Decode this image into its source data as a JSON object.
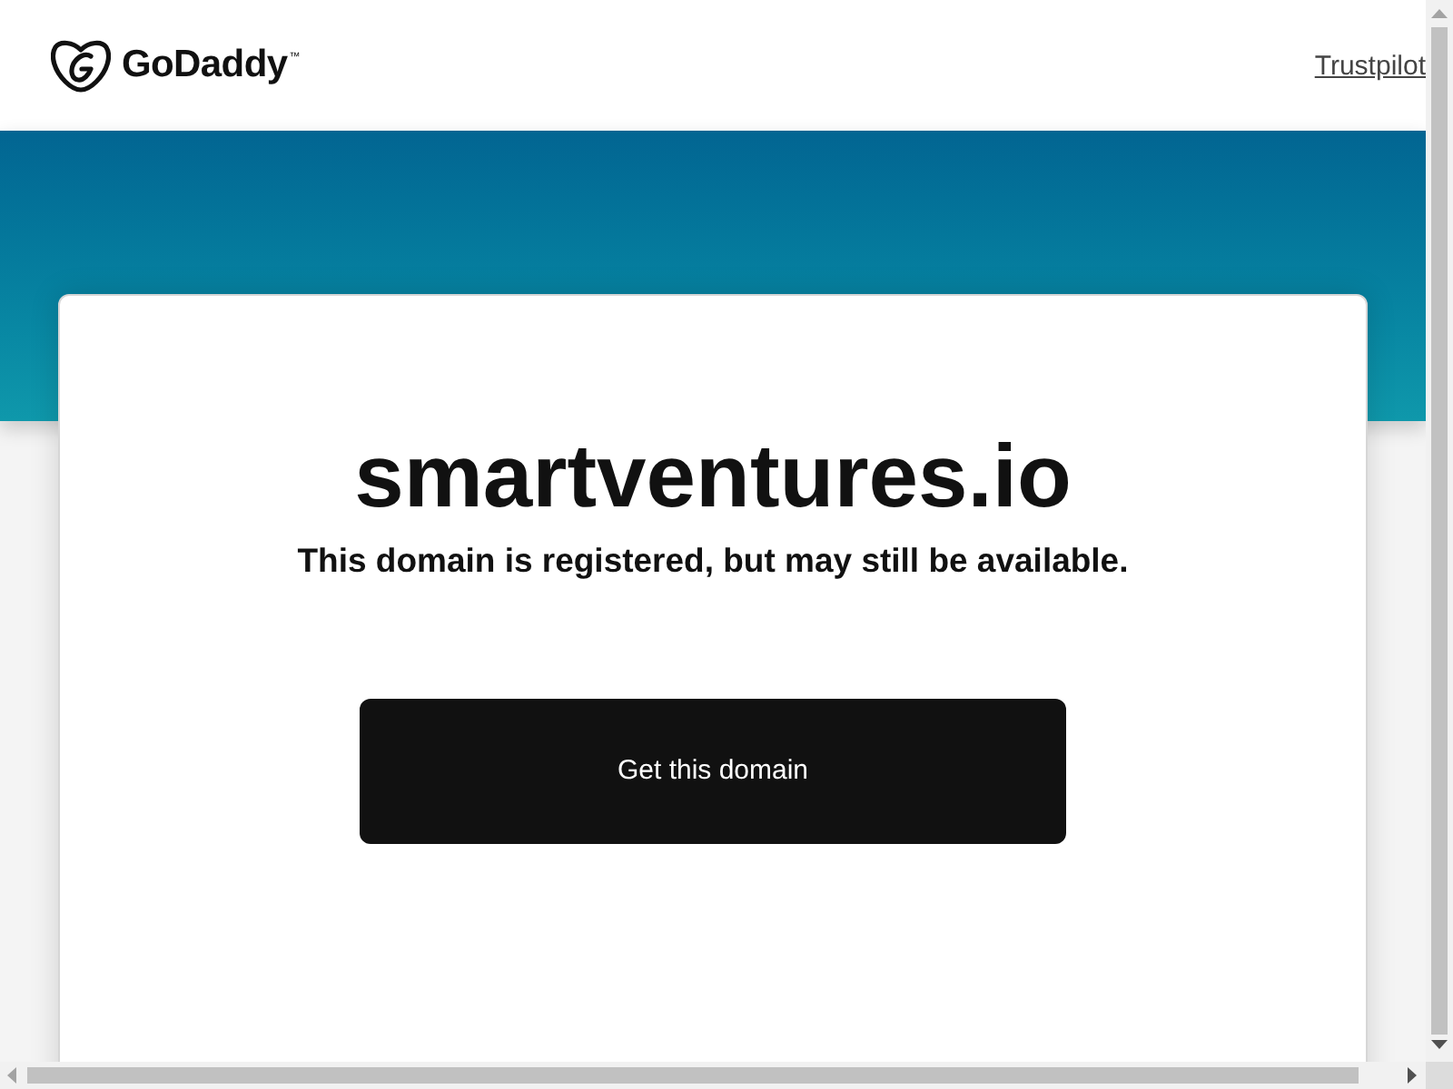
{
  "header": {
    "logo": {
      "text": "GoDaddy",
      "mark": "™"
    },
    "links": [
      {
        "label": "Trustpilot"
      }
    ]
  },
  "card": {
    "domain": "smartventures.io",
    "message": "This domain is registered, but may still be available.",
    "button": {
      "label": "Get this domain"
    }
  }
}
